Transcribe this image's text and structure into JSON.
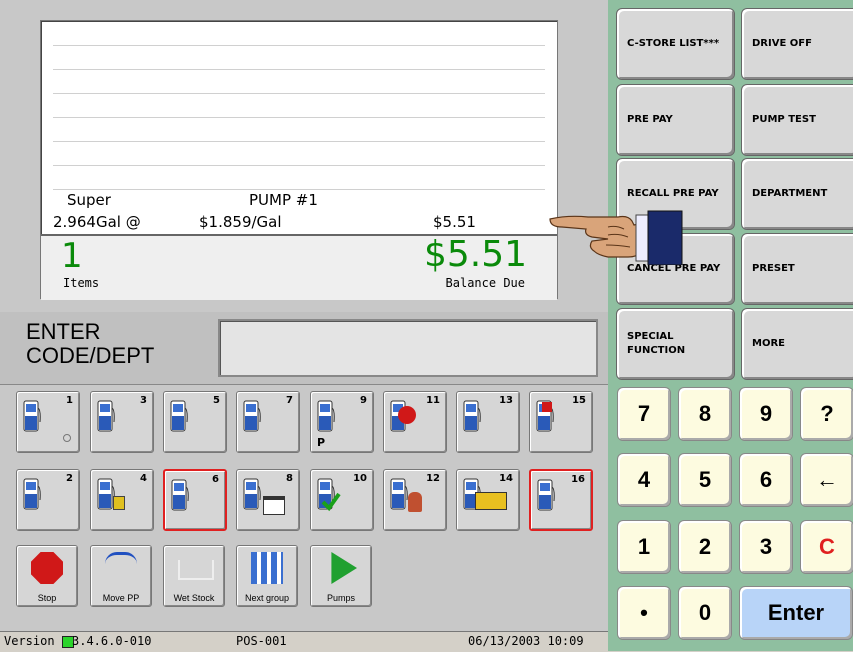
{
  "receipt": {
    "line1_desc": "Super",
    "line1_pump": "PUMP  #1",
    "line2_qty": "2.964Gal  @",
    "line2_price": "$1.859/Gal",
    "line2_amount": "$5.51",
    "items_count": "1",
    "items_label": "Items",
    "balance_value": "$5.51",
    "balance_label": "Balance Due"
  },
  "entry": {
    "label_line1": "ENTER",
    "label_line2": "CODE/DEPT",
    "value": ""
  },
  "pumps": [
    {
      "num": "1",
      "selected": false,
      "extra": "dot"
    },
    {
      "num": "3",
      "selected": false,
      "extra": ""
    },
    {
      "num": "5",
      "selected": false,
      "extra": ""
    },
    {
      "num": "7",
      "selected": false,
      "extra": ""
    },
    {
      "num": "9",
      "selected": false,
      "extra": "P"
    },
    {
      "num": "11",
      "selected": false,
      "extra": "stop"
    },
    {
      "num": "13",
      "selected": false,
      "extra": ""
    },
    {
      "num": "15",
      "selected": false,
      "extra": "x"
    },
    {
      "num": "2",
      "selected": false,
      "extra": ""
    },
    {
      "num": "4",
      "selected": false,
      "extra": "lock"
    },
    {
      "num": "6",
      "selected": true,
      "extra": ""
    },
    {
      "num": "8",
      "selected": false,
      "extra": "card"
    },
    {
      "num": "10",
      "selected": false,
      "extra": "check"
    },
    {
      "num": "12",
      "selected": false,
      "extra": "worker"
    },
    {
      "num": "14",
      "selected": false,
      "extra": "truck"
    },
    {
      "num": "16",
      "selected": true,
      "extra": ""
    }
  ],
  "functions": [
    {
      "label": "Stop",
      "icon": "stop-sign-icon"
    },
    {
      "label": "Move PP",
      "icon": "move-prepay-icon"
    },
    {
      "label": "Wet Stock",
      "icon": "wet-stock-icon"
    },
    {
      "label": "Next group",
      "icon": "next-group-icon"
    },
    {
      "label": "Pumps",
      "icon": "pumps-icon"
    }
  ],
  "status": {
    "version_prefix": "Version",
    "version": "3.4.6.0-010",
    "pos": "POS-001",
    "datetime": "06/13/2003 10:09"
  },
  "right_buttons": [
    {
      "label": "C-STORE LIST***"
    },
    {
      "label": "DRIVE OFF"
    },
    {
      "label": "PRE PAY"
    },
    {
      "label": "PUMP TEST"
    },
    {
      "label": "RECALL PRE PAY"
    },
    {
      "label": "DEPARTMENT"
    },
    {
      "label": "CANCEL PRE PAY"
    },
    {
      "label": "PRESET"
    },
    {
      "label": "SPECIAL FUNCTION"
    },
    {
      "label": "MORE"
    }
  ],
  "keypad": [
    "7",
    "8",
    "9",
    "?",
    "4",
    "5",
    "6",
    "←",
    "1",
    "2",
    "3",
    "C",
    "•",
    "0",
    "Enter"
  ],
  "colors": {
    "amount_green": "#0a8a0a",
    "right_panel": "#8fbfa0",
    "keypad": "#fdfbe0",
    "enter_key": "#b8d4f8",
    "clear_red": "#e02020",
    "selected_border": "#e02020"
  }
}
